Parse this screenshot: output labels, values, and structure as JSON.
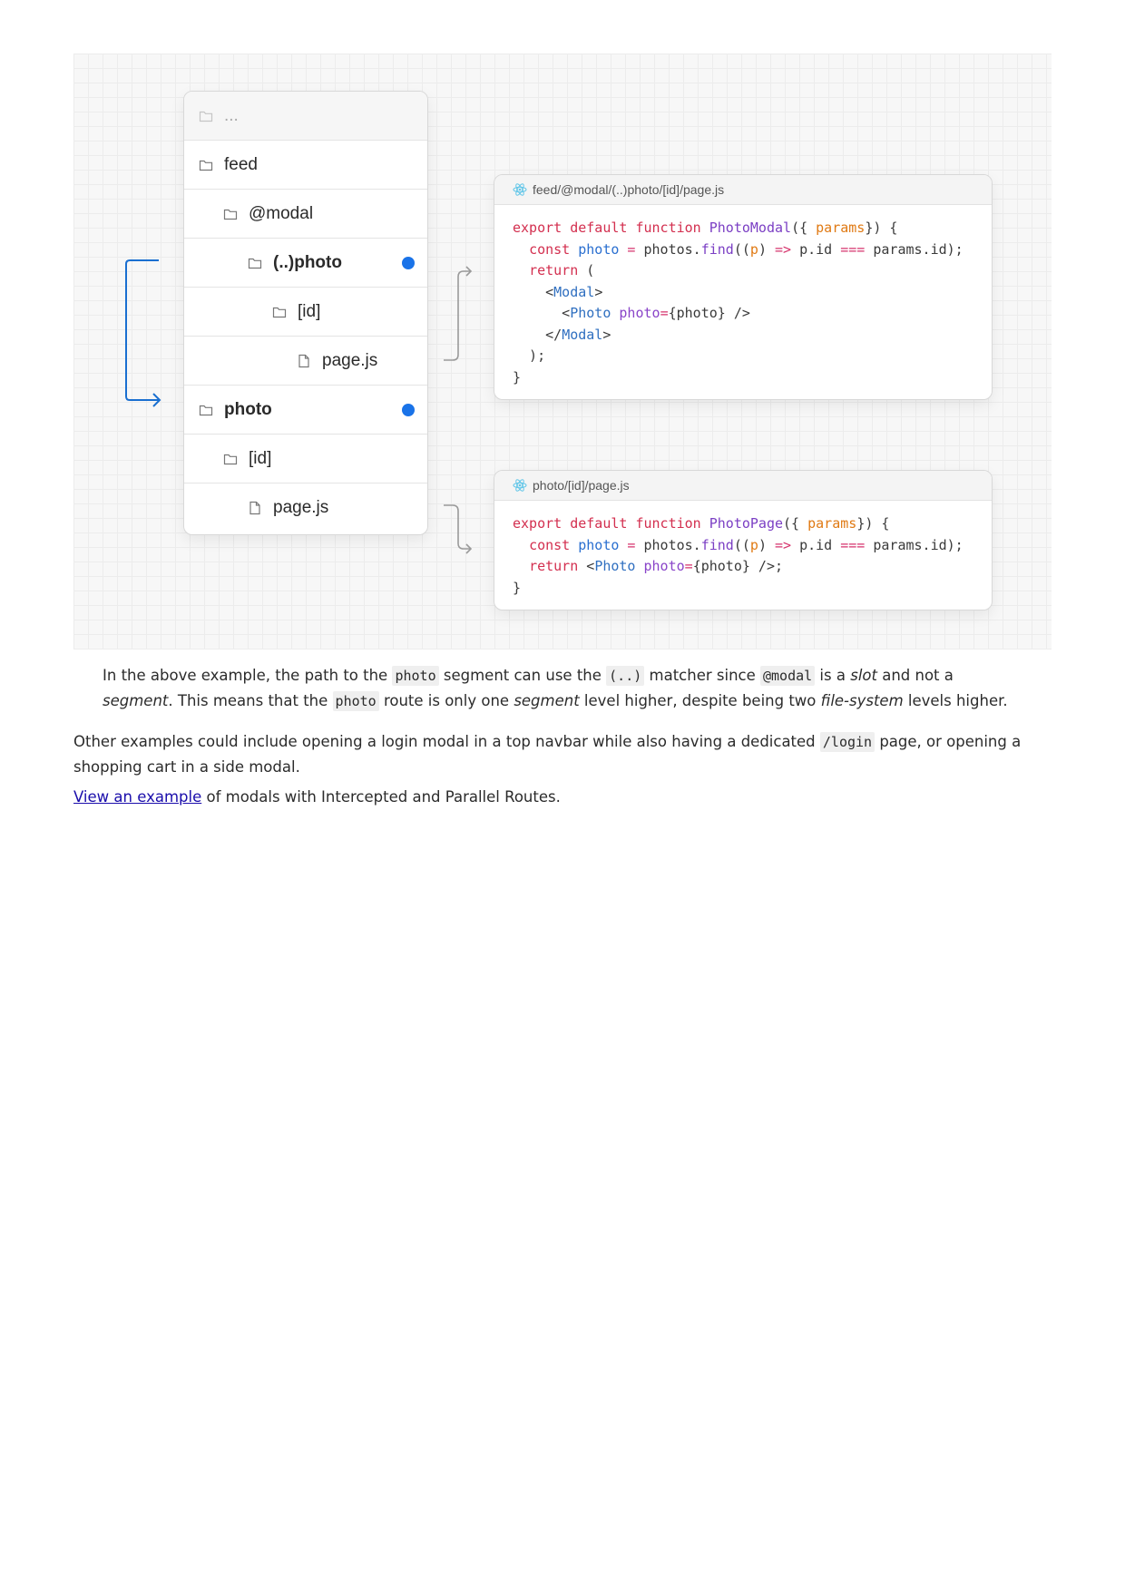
{
  "figure": {
    "tree": [
      {
        "label": "..."
      },
      {
        "label": "feed"
      },
      {
        "label": "@modal"
      },
      {
        "label": "(..)photo"
      },
      {
        "label": "[id]"
      },
      {
        "label": "page.js"
      },
      {
        "label": "photo"
      },
      {
        "label": "[id]"
      },
      {
        "label": "page.js"
      }
    ],
    "card1": {
      "title": "feed/@modal/(..)photo/[id]/page.js",
      "code": [
        [
          [
            "k",
            "export default function "
          ],
          [
            "f",
            "PhotoModal"
          ],
          [
            "",
            "({ "
          ],
          [
            "p",
            "params"
          ],
          [
            "",
            "}) {"
          ]
        ],
        [
          [
            "",
            "  "
          ],
          [
            "k",
            "const "
          ],
          [
            "v",
            "photo"
          ],
          [
            "o",
            " = "
          ],
          [
            "",
            "photos."
          ],
          [
            "f",
            "find"
          ],
          [
            "",
            "(("
          ],
          [
            "p",
            "p"
          ],
          [
            "",
            ") "
          ],
          [
            "o",
            "=>"
          ],
          [
            "",
            " p.id "
          ],
          [
            "o",
            "==="
          ],
          [
            "",
            " params.id);"
          ]
        ],
        [
          [
            "",
            "  "
          ],
          [
            "k",
            "return "
          ],
          [
            "",
            "("
          ]
        ],
        [
          [
            "",
            "    <"
          ],
          [
            "t",
            "Modal"
          ],
          [
            "",
            ">"
          ]
        ],
        [
          [
            "",
            "      <"
          ],
          [
            "t",
            "Photo "
          ],
          [
            "a",
            "photo"
          ],
          [
            "o",
            "="
          ],
          [
            "",
            "{photo} />"
          ]
        ],
        [
          [
            "",
            "    </"
          ],
          [
            "t",
            "Modal"
          ],
          [
            "",
            ">"
          ]
        ],
        [
          [
            "",
            "  );"
          ]
        ],
        [
          [
            "",
            "}"
          ]
        ]
      ]
    },
    "card2": {
      "title": "photo/[id]/page.js",
      "code": [
        [
          [
            "k",
            "export default function "
          ],
          [
            "f",
            "PhotoPage"
          ],
          [
            "",
            "({ "
          ],
          [
            "p",
            "params"
          ],
          [
            "",
            "}) {"
          ]
        ],
        [
          [
            "",
            "  "
          ],
          [
            "k",
            "const "
          ],
          [
            "v",
            "photo"
          ],
          [
            "o",
            " = "
          ],
          [
            "",
            "photos."
          ],
          [
            "f",
            "find"
          ],
          [
            "",
            "(("
          ],
          [
            "p",
            "p"
          ],
          [
            "",
            ") "
          ],
          [
            "o",
            "=>"
          ],
          [
            "",
            " p.id "
          ],
          [
            "o",
            "==="
          ],
          [
            "",
            " params.id);"
          ]
        ],
        [
          [
            "",
            "  "
          ],
          [
            "k",
            "return "
          ],
          [
            "",
            "<"
          ],
          [
            "t",
            "Photo "
          ],
          [
            "a",
            "photo"
          ],
          [
            "o",
            "="
          ],
          [
            "",
            "{photo} />;"
          ]
        ],
        [
          [
            "",
            "}"
          ]
        ]
      ]
    }
  },
  "text": {
    "p1": [
      {
        "t": "In the above example, the path to the "
      },
      {
        "t": "photo",
        "s": "code"
      },
      {
        "t": " segment can use the "
      },
      {
        "t": "(..)",
        "s": "code"
      },
      {
        "t": " matcher since "
      },
      {
        "t": "@modal",
        "s": "code"
      },
      {
        "t": " is a "
      },
      {
        "t": "slot",
        "s": "em"
      },
      {
        "t": " and not a "
      },
      {
        "t": "segment",
        "s": "em"
      },
      {
        "t": ". This means that the "
      },
      {
        "t": "photo",
        "s": "code"
      },
      {
        "t": " route is only one "
      },
      {
        "t": "segment",
        "s": "em"
      },
      {
        "t": " level higher, despite being two "
      },
      {
        "t": "file-system",
        "s": "em"
      },
      {
        "t": " levels higher."
      }
    ],
    "p2": [
      {
        "t": "Other examples could include opening a login modal in a top navbar while also having a dedicated "
      },
      {
        "t": "/login",
        "s": "code"
      },
      {
        "t": " page, or opening a shopping cart in a side modal."
      }
    ],
    "p3": [
      {
        "t": "View an example",
        "s": "link"
      },
      {
        "t": " of modals with Intercepted and Parallel Routes."
      }
    ]
  }
}
